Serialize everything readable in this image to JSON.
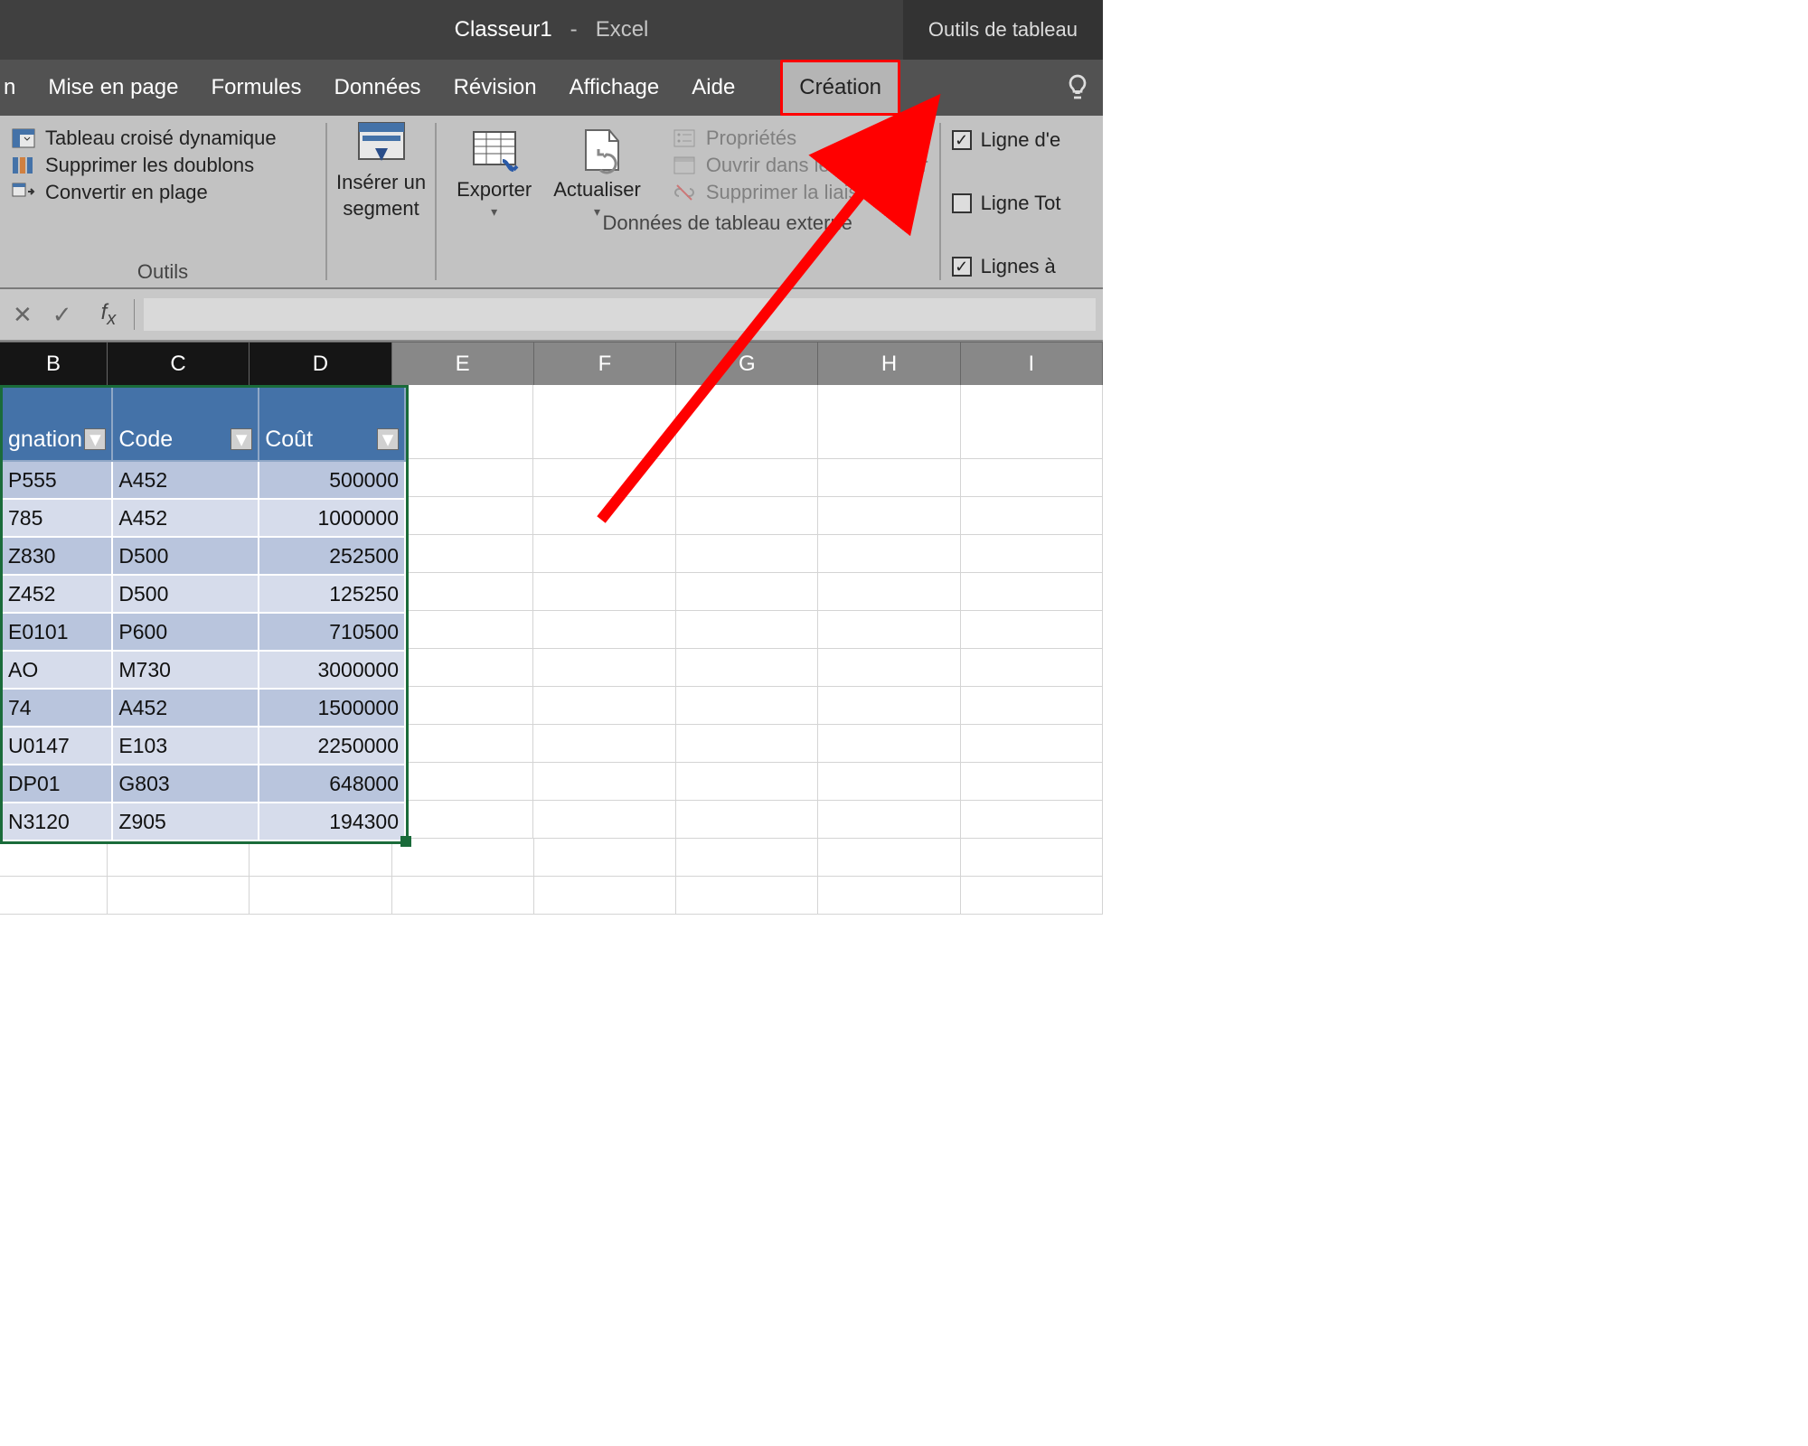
{
  "title": {
    "file": "Classeur1",
    "app": "Excel",
    "context_tab": "Outils de tableau"
  },
  "ribbon_tabs": {
    "partial_first": "n",
    "items": [
      "Mise en page",
      "Formules",
      "Données",
      "Révision",
      "Affichage",
      "Aide"
    ],
    "active": "Création"
  },
  "ribbon": {
    "tools": {
      "pivot": "Tableau croisé dynamique",
      "dedupe": "Supprimer les doublons",
      "convert": "Convertir en plage",
      "group_label": "Outils"
    },
    "slicer": {
      "line1": "Insérer un",
      "line2": "segment"
    },
    "export": "Exporter",
    "refresh": "Actualiser",
    "external": {
      "properties": "Propriétés",
      "open_browser": "Ouvrir dans le navigateur",
      "unlink": "Supprimer la liaison",
      "group_label": "Données de tableau externe"
    },
    "style_opts": {
      "header_row": "Ligne d'e",
      "total_row": "Ligne Tot",
      "banded_rows": "Lignes à "
    }
  },
  "columns": [
    "B",
    "C",
    "D",
    "E",
    "F",
    "G",
    "H",
    "I"
  ],
  "table": {
    "headers": {
      "b_partial": "gnation",
      "c": "Code",
      "d": "Coût"
    },
    "rows": [
      {
        "b": "P555",
        "c": "A452",
        "d": "500000"
      },
      {
        "b": "785",
        "c": "A452",
        "d": "1000000"
      },
      {
        "b": "Z830",
        "c": "D500",
        "d": "252500"
      },
      {
        "b": "Z452",
        "c": "D500",
        "d": "125250"
      },
      {
        "b": "E0101",
        "c": "P600",
        "d": "710500"
      },
      {
        "b": "AO",
        "c": "M730",
        "d": "3000000"
      },
      {
        "b": "74",
        "c": "A452",
        "d": "1500000"
      },
      {
        "b": "U0147",
        "c": "E103",
        "d": "2250000"
      },
      {
        "b": "DP01",
        "c": "G803",
        "d": "648000"
      },
      {
        "b": "N3120",
        "c": "Z905",
        "d": "194300"
      }
    ]
  },
  "annotation": {
    "kind": "red-arrow",
    "target": "tab-creation"
  }
}
